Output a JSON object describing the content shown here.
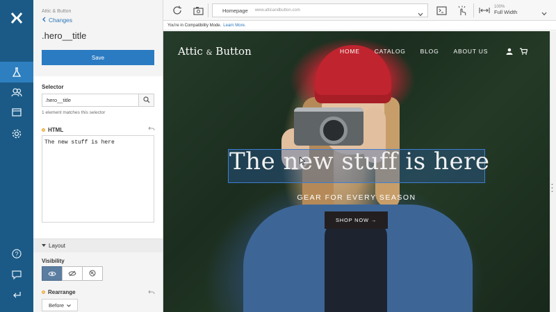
{
  "sidebar": {
    "breadcrumb": "Attic & Button",
    "back_label": "Changes",
    "selected_title": ".hero__title",
    "save_label": "Save",
    "selector_label": "Selector",
    "selector_value": ".hero__title",
    "matches_text": "1 element matches this selector",
    "html_label": "HTML",
    "html_value": "The new stuff is here",
    "layout_label": "Layout",
    "visibility_label": "Visibility",
    "rearrange_label": "Rearrange",
    "rearrange_value": "Before"
  },
  "toolbar": {
    "page_name": "Homepage",
    "page_url": "www.atticandbutton.com",
    "zoom_percent": "100%",
    "zoom_mode": "Full Width"
  },
  "compat": {
    "text": "You're in Compatibility Mode.",
    "link": "Learn More."
  },
  "preview": {
    "site_name": "Attic",
    "site_amp": "&",
    "site_name2": "Button",
    "nav": [
      "HOME",
      "CATALOG",
      "BLOG",
      "ABOUT US"
    ],
    "hero_title": "The new stuff is here",
    "hero_subtitle": "GEAR FOR EVERY SEASON",
    "cta_label": "SHOP NOW →"
  },
  "colors": {
    "rail": "#1b5a86",
    "accent": "#2a7bc2",
    "highlight": "#3d7ed1"
  },
  "icons": [
    "app-logo-icon",
    "experiments-icon",
    "audiences-icon",
    "pages-icon",
    "settings-icon",
    "help-icon",
    "feedback-icon",
    "exit-icon",
    "refresh-icon",
    "screenshot-icon",
    "code-icon",
    "interactive-mode-icon",
    "width-icon",
    "user-icon",
    "cart-icon"
  ]
}
